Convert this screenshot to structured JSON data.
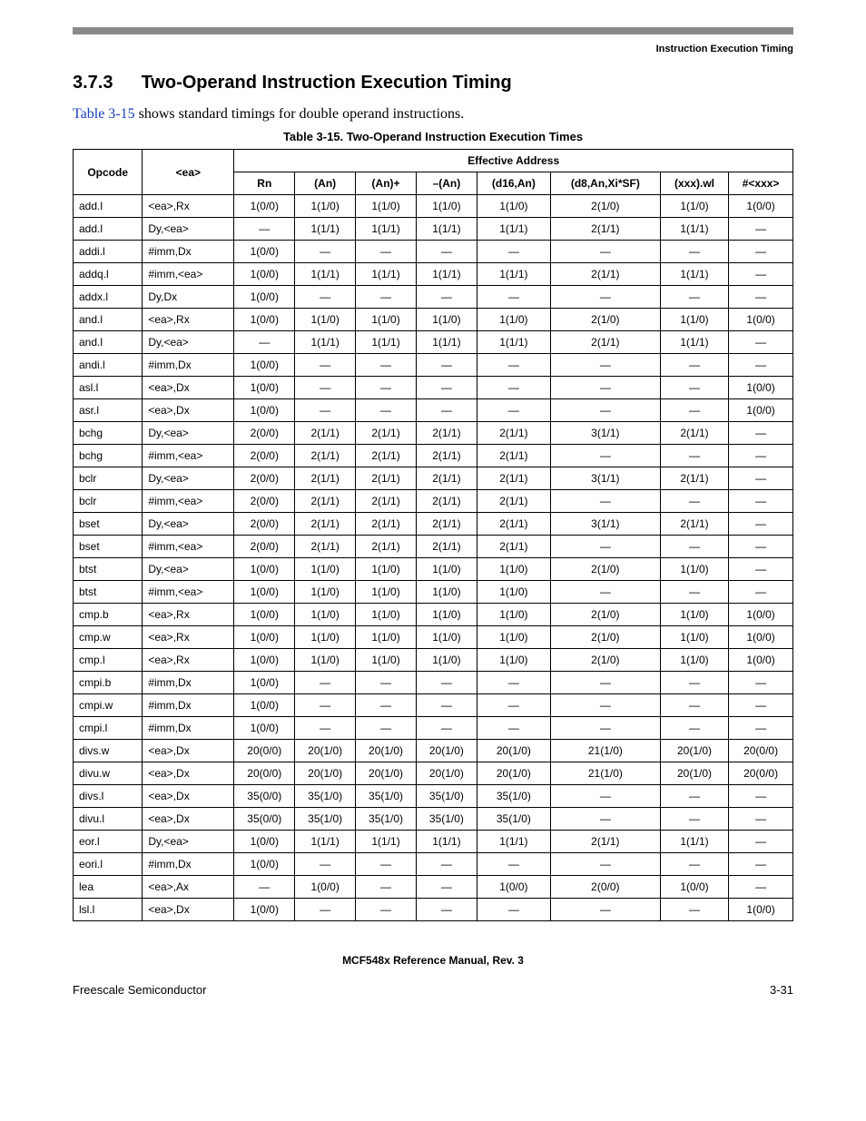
{
  "header_right": "Instruction Execution Timing",
  "section_number": "3.7.3",
  "section_title": "Two-Operand Instruction Execution Timing",
  "intro_link": "Table 3-15",
  "intro_rest": " shows standard timings for double operand instructions.",
  "table_caption": "Table 3-15. Two-Operand Instruction Execution Times",
  "columns": {
    "opcode": "Opcode",
    "ea": "<ea>",
    "group": "Effective Address",
    "rn": "Rn",
    "an": "(An)",
    "anp": "(An)+",
    "man": "–(An)",
    "d16": "(d16,An)",
    "d8": "(d8,An,Xi*SF)",
    "xxxwl": "(xxx).wl",
    "pxxx": "#<xxx>"
  },
  "chart_data": {
    "type": "table",
    "title": "Table 3-15. Two-Operand Instruction Execution Times",
    "columns": [
      "Opcode",
      "<ea>",
      "Rn",
      "(An)",
      "(An)+",
      "–(An)",
      "(d16,An)",
      "(d8,An,Xi*SF)",
      "(xxx).wl",
      "#<xxx>"
    ],
    "rows": [
      {
        "opcode": "add.l",
        "ea": "<ea>,Rx",
        "rn": "1(0/0)",
        "an": "1(1/0)",
        "anp": "1(1/0)",
        "man": "1(1/0)",
        "d16": "1(1/0)",
        "d8": "2(1/0)",
        "xxxwl": "1(1/0)",
        "pxxx": "1(0/0)"
      },
      {
        "opcode": "add.l",
        "ea": "Dy,<ea>",
        "rn": "—",
        "an": "1(1/1)",
        "anp": "1(1/1)",
        "man": "1(1/1)",
        "d16": "1(1/1)",
        "d8": "2(1/1)",
        "xxxwl": "1(1/1)",
        "pxxx": "—"
      },
      {
        "opcode": "addi.l",
        "ea": "#imm,Dx",
        "rn": "1(0/0)",
        "an": "—",
        "anp": "—",
        "man": "—",
        "d16": "—",
        "d8": "—",
        "xxxwl": "—",
        "pxxx": "—"
      },
      {
        "opcode": "addq.l",
        "ea": "#imm,<ea>",
        "rn": "1(0/0)",
        "an": "1(1/1)",
        "anp": "1(1/1)",
        "man": "1(1/1)",
        "d16": "1(1/1)",
        "d8": "2(1/1)",
        "xxxwl": "1(1/1)",
        "pxxx": "—"
      },
      {
        "opcode": "addx.l",
        "ea": "Dy,Dx",
        "rn": "1(0/0)",
        "an": "—",
        "anp": "—",
        "man": "—",
        "d16": "—",
        "d8": "—",
        "xxxwl": "—",
        "pxxx": "—"
      },
      {
        "opcode": "and.l",
        "ea": "<ea>,Rx",
        "rn": "1(0/0)",
        "an": "1(1/0)",
        "anp": "1(1/0)",
        "man": "1(1/0)",
        "d16": "1(1/0)",
        "d8": "2(1/0)",
        "xxxwl": "1(1/0)",
        "pxxx": "1(0/0)"
      },
      {
        "opcode": "and.l",
        "ea": "Dy,<ea>",
        "rn": "—",
        "an": "1(1/1)",
        "anp": "1(1/1)",
        "man": "1(1/1)",
        "d16": "1(1/1)",
        "d8": "2(1/1)",
        "xxxwl": "1(1/1)",
        "pxxx": "—"
      },
      {
        "opcode": "andi.l",
        "ea": "#imm,Dx",
        "rn": "1(0/0)",
        "an": "—",
        "anp": "—",
        "man": "—",
        "d16": "—",
        "d8": "—",
        "xxxwl": "—",
        "pxxx": "—"
      },
      {
        "opcode": "asl.l",
        "ea": "<ea>,Dx",
        "rn": "1(0/0)",
        "an": "—",
        "anp": "—",
        "man": "—",
        "d16": "—",
        "d8": "—",
        "xxxwl": "—",
        "pxxx": "1(0/0)"
      },
      {
        "opcode": "asr.l",
        "ea": "<ea>,Dx",
        "rn": "1(0/0)",
        "an": "—",
        "anp": "—",
        "man": "—",
        "d16": "—",
        "d8": "—",
        "xxxwl": "—",
        "pxxx": "1(0/0)"
      },
      {
        "opcode": "bchg",
        "ea": "Dy,<ea>",
        "rn": "2(0/0)",
        "an": "2(1/1)",
        "anp": "2(1/1)",
        "man": "2(1/1)",
        "d16": "2(1/1)",
        "d8": "3(1/1)",
        "xxxwl": "2(1/1)",
        "pxxx": "—"
      },
      {
        "opcode": "bchg",
        "ea": "#imm,<ea>",
        "rn": "2(0/0)",
        "an": "2(1/1)",
        "anp": "2(1/1)",
        "man": "2(1/1)",
        "d16": "2(1/1)",
        "d8": "—",
        "xxxwl": "—",
        "pxxx": "—"
      },
      {
        "opcode": "bclr",
        "ea": "Dy,<ea>",
        "rn": "2(0/0)",
        "an": "2(1/1)",
        "anp": "2(1/1)",
        "man": "2(1/1)",
        "d16": "2(1/1)",
        "d8": "3(1/1)",
        "xxxwl": "2(1/1)",
        "pxxx": "—"
      },
      {
        "opcode": "bclr",
        "ea": "#imm,<ea>",
        "rn": "2(0/0)",
        "an": "2(1/1)",
        "anp": "2(1/1)",
        "man": "2(1/1)",
        "d16": "2(1/1)",
        "d8": "—",
        "xxxwl": "—",
        "pxxx": "—"
      },
      {
        "opcode": "bset",
        "ea": "Dy,<ea>",
        "rn": "2(0/0)",
        "an": "2(1/1)",
        "anp": "2(1/1)",
        "man": "2(1/1)",
        "d16": "2(1/1)",
        "d8": "3(1/1)",
        "xxxwl": "2(1/1)",
        "pxxx": "—"
      },
      {
        "opcode": "bset",
        "ea": "#imm,<ea>",
        "rn": "2(0/0)",
        "an": "2(1/1)",
        "anp": "2(1/1)",
        "man": "2(1/1)",
        "d16": "2(1/1)",
        "d8": "—",
        "xxxwl": "—",
        "pxxx": "—"
      },
      {
        "opcode": "btst",
        "ea": "Dy,<ea>",
        "rn": "1(0/0)",
        "an": "1(1/0)",
        "anp": "1(1/0)",
        "man": "1(1/0)",
        "d16": "1(1/0)",
        "d8": "2(1/0)",
        "xxxwl": "1(1/0)",
        "pxxx": "—"
      },
      {
        "opcode": "btst",
        "ea": "#imm,<ea>",
        "rn": "1(0/0)",
        "an": "1(1/0)",
        "anp": "1(1/0)",
        "man": "1(1/0)",
        "d16": "1(1/0)",
        "d8": "—",
        "xxxwl": "—",
        "pxxx": "—"
      },
      {
        "opcode": "cmp.b",
        "ea": "<ea>,Rx",
        "rn": "1(0/0)",
        "an": "1(1/0)",
        "anp": "1(1/0)",
        "man": "1(1/0)",
        "d16": "1(1/0)",
        "d8": "2(1/0)",
        "xxxwl": "1(1/0)",
        "pxxx": "1(0/0)"
      },
      {
        "opcode": "cmp.w",
        "ea": "<ea>,Rx",
        "rn": "1(0/0)",
        "an": "1(1/0)",
        "anp": "1(1/0)",
        "man": "1(1/0)",
        "d16": "1(1/0)",
        "d8": "2(1/0)",
        "xxxwl": "1(1/0)",
        "pxxx": "1(0/0)"
      },
      {
        "opcode": "cmp.l",
        "ea": "<ea>,Rx",
        "rn": "1(0/0)",
        "an": "1(1/0)",
        "anp": "1(1/0)",
        "man": "1(1/0)",
        "d16": "1(1/0)",
        "d8": "2(1/0)",
        "xxxwl": "1(1/0)",
        "pxxx": "1(0/0)"
      },
      {
        "opcode": "cmpi.b",
        "ea": "#imm,Dx",
        "rn": "1(0/0)",
        "an": "—",
        "anp": "—",
        "man": "—",
        "d16": "—",
        "d8": "—",
        "xxxwl": "—",
        "pxxx": "—"
      },
      {
        "opcode": "cmpi.w",
        "ea": "#imm,Dx",
        "rn": "1(0/0)",
        "an": "—",
        "anp": "—",
        "man": "—",
        "d16": "—",
        "d8": "—",
        "xxxwl": "—",
        "pxxx": "—"
      },
      {
        "opcode": "cmpi.l",
        "ea": "#imm,Dx",
        "rn": "1(0/0)",
        "an": "—",
        "anp": "—",
        "man": "—",
        "d16": "—",
        "d8": "—",
        "xxxwl": "—",
        "pxxx": "—"
      },
      {
        "opcode": "divs.w",
        "ea": "<ea>,Dx",
        "rn": "20(0/0)",
        "an": "20(1/0)",
        "anp": "20(1/0)",
        "man": "20(1/0)",
        "d16": "20(1/0)",
        "d8": "21(1/0)",
        "xxxwl": "20(1/0)",
        "pxxx": "20(0/0)"
      },
      {
        "opcode": "divu.w",
        "ea": "<ea>,Dx",
        "rn": "20(0/0)",
        "an": "20(1/0)",
        "anp": "20(1/0)",
        "man": "20(1/0)",
        "d16": "20(1/0)",
        "d8": "21(1/0)",
        "xxxwl": "20(1/0)",
        "pxxx": "20(0/0)"
      },
      {
        "opcode": "divs.l",
        "ea": "<ea>,Dx",
        "rn": "35(0/0)",
        "an": "35(1/0)",
        "anp": "35(1/0)",
        "man": "35(1/0)",
        "d16": "35(1/0)",
        "d8": "—",
        "xxxwl": "—",
        "pxxx": "—"
      },
      {
        "opcode": "divu.l",
        "ea": "<ea>,Dx",
        "rn": "35(0/0)",
        "an": "35(1/0)",
        "anp": "35(1/0)",
        "man": "35(1/0)",
        "d16": "35(1/0)",
        "d8": "—",
        "xxxwl": "—",
        "pxxx": "—"
      },
      {
        "opcode": "eor.l",
        "ea": "Dy,<ea>",
        "rn": "1(0/0)",
        "an": "1(1/1)",
        "anp": "1(1/1)",
        "man": "1(1/1)",
        "d16": "1(1/1)",
        "d8": "2(1/1)",
        "xxxwl": "1(1/1)",
        "pxxx": "—"
      },
      {
        "opcode": "eori.l",
        "ea": "#imm,Dx",
        "rn": "1(0/0)",
        "an": "—",
        "anp": "—",
        "man": "—",
        "d16": "—",
        "d8": "—",
        "xxxwl": "—",
        "pxxx": "—"
      },
      {
        "opcode": "lea",
        "ea": "<ea>,Ax",
        "rn": "—",
        "an": "1(0/0)",
        "anp": "—",
        "man": "—",
        "d16": "1(0/0)",
        "d8": "2(0/0)",
        "xxxwl": "1(0/0)",
        "pxxx": "—"
      },
      {
        "opcode": "lsl.l",
        "ea": "<ea>,Dx",
        "rn": "1(0/0)",
        "an": "—",
        "anp": "—",
        "man": "—",
        "d16": "—",
        "d8": "—",
        "xxxwl": "—",
        "pxxx": "1(0/0)"
      }
    ]
  },
  "footer_center": "MCF548x Reference Manual, Rev. 3",
  "footer_left": "Freescale Semiconductor",
  "footer_right": "3-31"
}
